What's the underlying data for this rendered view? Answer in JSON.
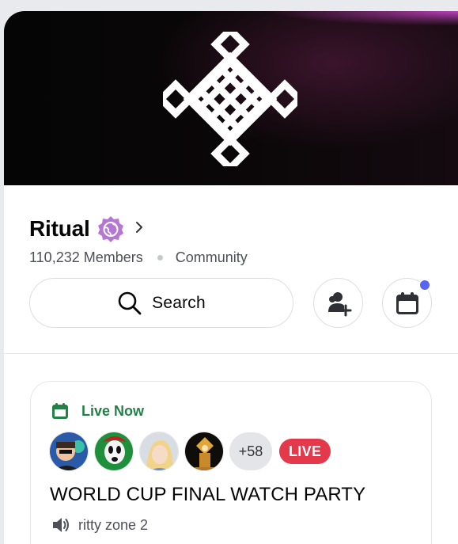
{
  "server": {
    "name": "Ritual",
    "members": "110,232 Members",
    "type": "Community"
  },
  "actions": {
    "search_label": "Search"
  },
  "event": {
    "status": "Live Now",
    "more_count": "+58",
    "live_badge": "LIVE",
    "title": "WORLD CUP FINAL WATCH PARTY",
    "channel": "ritty zone 2"
  },
  "colors": {
    "accent_blurple": "#5865f2",
    "live_green": "#248046",
    "live_red": "#e3394a",
    "badge_purple": "#b676d4"
  },
  "icons": [
    "ritual-knot-logo",
    "verified-badge-icon",
    "chevron-right-icon",
    "search-icon",
    "add-friend-icon",
    "calendar-icon",
    "voice-channel-icon"
  ]
}
